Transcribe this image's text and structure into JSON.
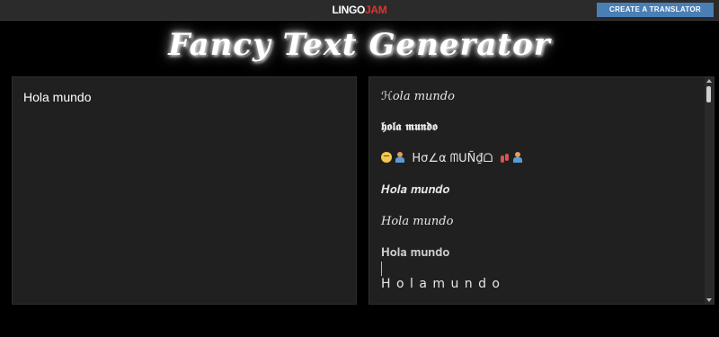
{
  "header": {
    "logo_part1": "LINGO",
    "logo_part2": "JAM",
    "cta_label": "CREATE A TRANSLATOR"
  },
  "title": "Fancy Text Generator",
  "input": {
    "value": "Hola mundo"
  },
  "outputs": [
    "ℋ𝑜𝑙𝑎 𝑚𝑢𝑛𝑑𝑜",
    "𝖍𝖔𝖑𝖆 𝖒𝖚𝖓𝖉𝖔",
    "Hσ∠α ᗰᑌÑ₫ᗝ",
    "𝑯𝒐𝒍𝒂 𝒎𝒖𝒏𝒅𝒐",
    "𝐻𝑜𝑙𝑎 𝑚𝑢𝑛𝑑𝑜",
    "𝐇𝐨𝐥𝐚 𝐦𝐮𝐧𝐝𝐨",
    "H o l a m u n d o"
  ],
  "colors": {
    "background": "#000000",
    "panel": "#202020",
    "topbar": "#2b2b2b",
    "button": "#4a7fb5",
    "logo_accent": "#e0332d"
  }
}
